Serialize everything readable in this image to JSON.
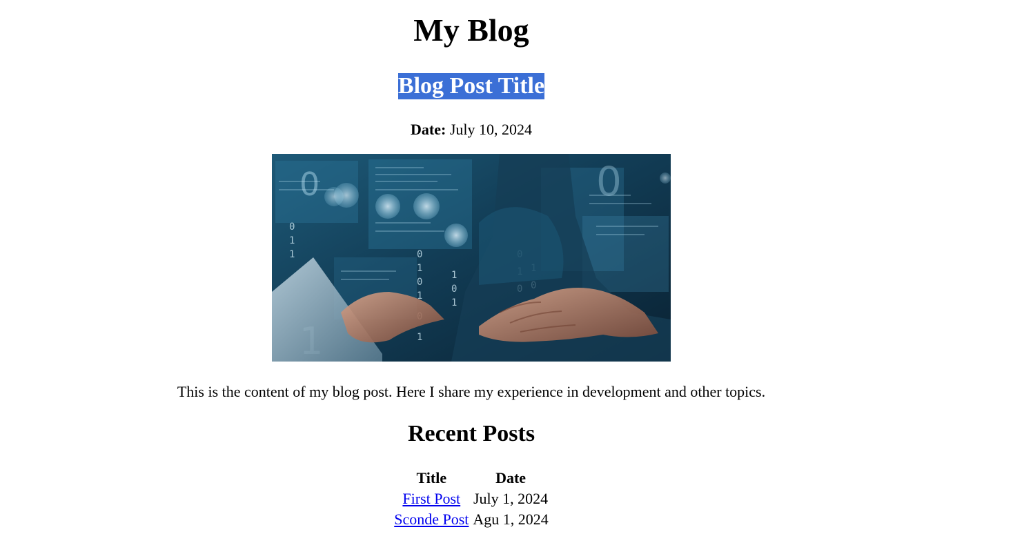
{
  "header": {
    "site_title": "My Blog"
  },
  "post": {
    "title": "Blog Post Title",
    "date_label": "Date:",
    "date_value": "July 10, 2024",
    "image": "blog-hero-image",
    "content": "This is the content of my blog post. Here I share my experience in development and other topics."
  },
  "recent_posts": {
    "heading": "Recent Posts",
    "columns": [
      "Title",
      "Date"
    ],
    "rows": [
      {
        "title": "First Post",
        "date": "July 1, 2024"
      },
      {
        "title": "Sconde Post",
        "date": "Agu 1, 2024"
      }
    ]
  },
  "colors": {
    "selection_highlight": "#3b6fd6",
    "link": "#0000ee"
  }
}
